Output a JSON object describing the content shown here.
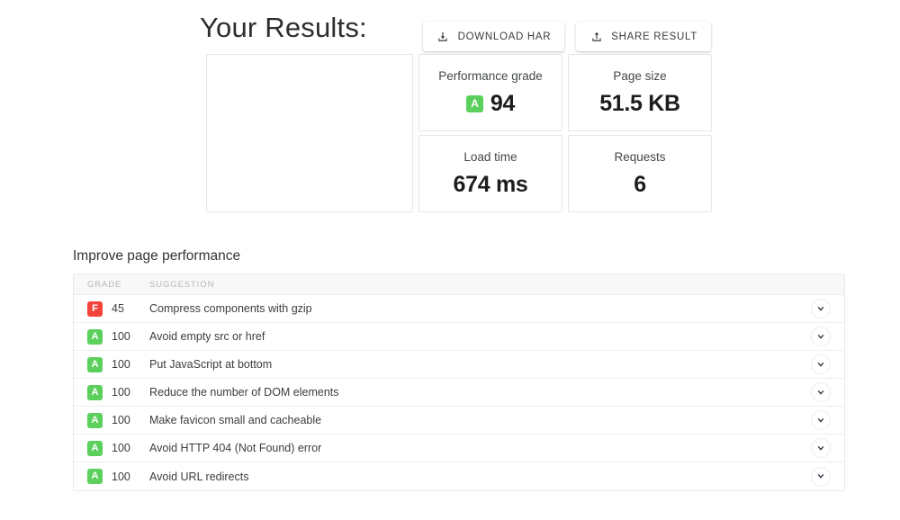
{
  "header": {
    "title": "Your Results:",
    "actions": [
      {
        "id": "download-har",
        "label": "DOWNLOAD HAR",
        "icon": "download-icon"
      },
      {
        "id": "share-result",
        "label": "SHARE RESULT",
        "icon": "upload-icon"
      }
    ]
  },
  "summary": {
    "chart_card": {
      "label": "",
      "value": ""
    },
    "cards": [
      {
        "id": "performance-grade",
        "label": "Performance grade",
        "value": "94",
        "grade": "A",
        "grade_color": "#5cd05c"
      },
      {
        "id": "page-size",
        "label": "Page size",
        "value": "51.5 KB"
      },
      {
        "id": "load-time",
        "label": "Load time",
        "value": "674 ms"
      },
      {
        "id": "requests",
        "label": "Requests",
        "value": "6"
      }
    ]
  },
  "improve": {
    "section_title": "Improve page performance",
    "columns": {
      "grade": "GRADE",
      "suggestion": "SUGGESTION"
    },
    "rows": [
      {
        "grade": "F",
        "grade_color": "#f4433c",
        "score": "45",
        "suggestion": "Compress components with gzip"
      },
      {
        "grade": "A",
        "grade_color": "#5cd05c",
        "score": "100",
        "suggestion": "Avoid empty src or href"
      },
      {
        "grade": "A",
        "grade_color": "#5cd05c",
        "score": "100",
        "suggestion": "Put JavaScript at bottom"
      },
      {
        "grade": "A",
        "grade_color": "#5cd05c",
        "score": "100",
        "suggestion": "Reduce the number of DOM elements"
      },
      {
        "grade": "A",
        "grade_color": "#5cd05c",
        "score": "100",
        "suggestion": "Make favicon small and cacheable"
      },
      {
        "grade": "A",
        "grade_color": "#5cd05c",
        "score": "100",
        "suggestion": "Avoid HTTP 404 (Not Found) error"
      },
      {
        "grade": "A",
        "grade_color": "#5cd05c",
        "score": "100",
        "suggestion": "Avoid URL redirects"
      }
    ],
    "toggle_icon": "chevron-down-icon"
  }
}
